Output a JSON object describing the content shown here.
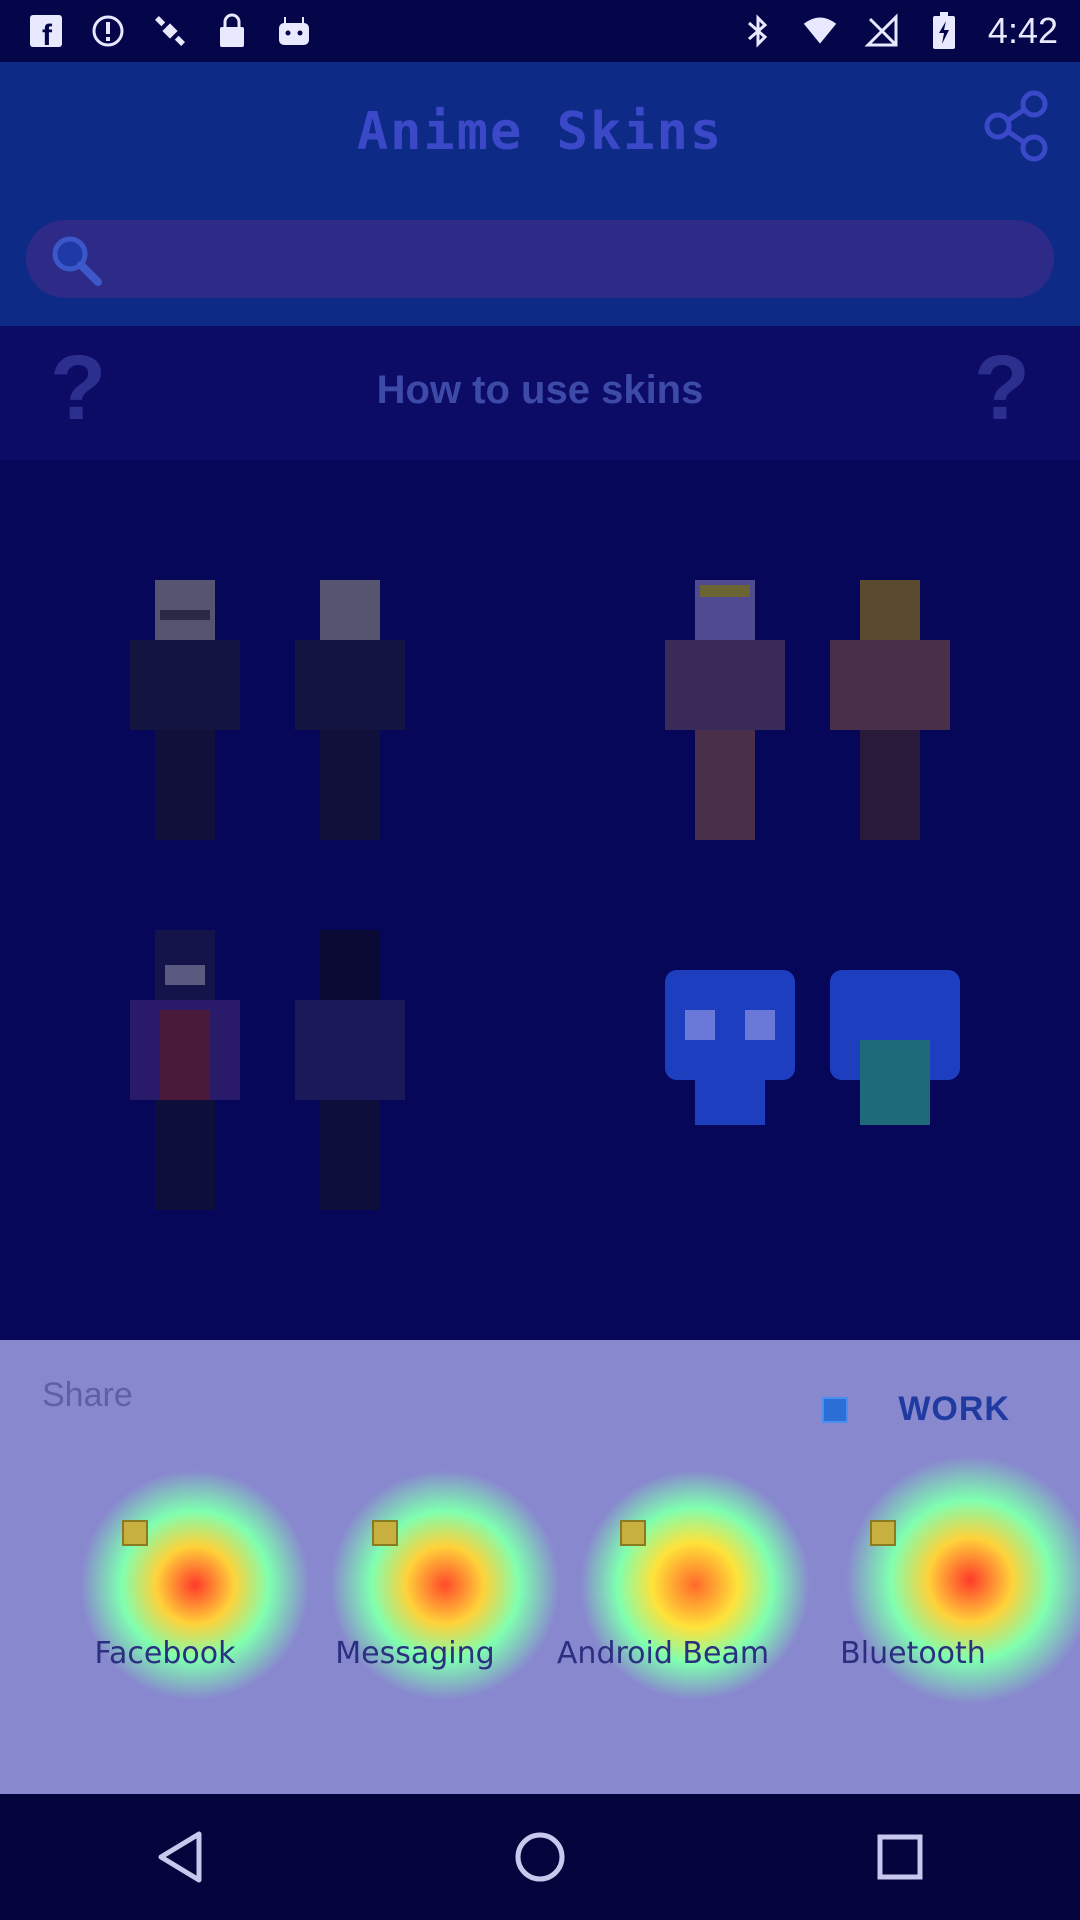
{
  "status_bar": {
    "left_icons": [
      "facebook-icon",
      "alert-circle-icon",
      "satellite-icon",
      "lock-icon",
      "android-icon"
    ],
    "right_icons": [
      "bluetooth-icon",
      "wifi-icon",
      "no-signal-icon",
      "battery-charging-icon"
    ],
    "time": "4:42"
  },
  "app_bar": {
    "title": "Anime Skins",
    "share_icon": "share-icon",
    "search_placeholder": ""
  },
  "help_row": {
    "label": "How to use skins",
    "icon": "question-mark-icon"
  },
  "share_sheet": {
    "heading": "Share",
    "profile_tab": "WORK",
    "targets": [
      {
        "name": "Facebook"
      },
      {
        "name": "Messaging"
      },
      {
        "name": "Android Beam"
      },
      {
        "name": "Bluetooth"
      }
    ]
  },
  "nav_bar": {
    "buttons": [
      "back-icon",
      "home-icon",
      "recents-icon"
    ]
  },
  "colors": {
    "overlay": "#0a0a5e",
    "sheet": "#8888cf",
    "accent": "#1f3aa0"
  }
}
